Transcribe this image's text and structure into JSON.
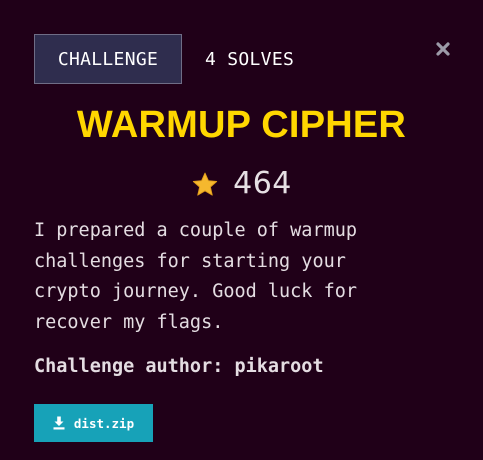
{
  "tabs": {
    "challenge_label": "CHALLENGE",
    "solves_label": "4 SOLVES"
  },
  "close_icon": "close-icon",
  "challenge": {
    "title": "WARMUP CIPHER",
    "points": "464",
    "points_icon": "star-icon",
    "description": "I prepared a couple of warmup\nchallenges for starting your\ncrypto journey. Good luck for\nrecover my flags.",
    "author_label": "Challenge author: pikaroot"
  },
  "file": {
    "name": "dist.zip",
    "icon": "download-icon"
  },
  "colors": {
    "background": "#200018",
    "title": "#ffd700",
    "tab_active_bg": "#2f2d4e",
    "download_button": "#17a2b8",
    "star": "#f5b82e"
  }
}
